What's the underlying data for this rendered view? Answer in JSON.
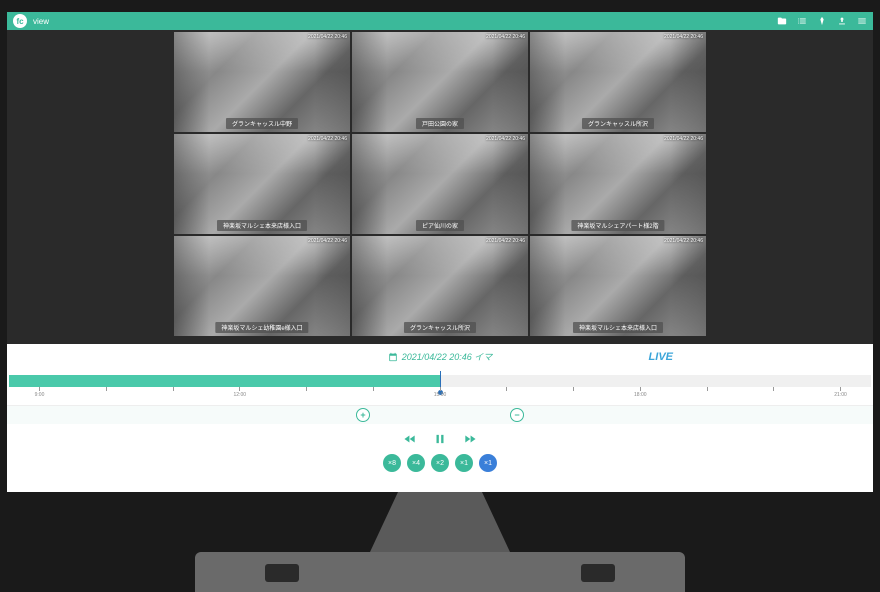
{
  "app": {
    "title": "view"
  },
  "header_icons": [
    "folder-icon",
    "list-icon",
    "diamond-icon",
    "upload-icon",
    "menu-icon"
  ],
  "cameras": [
    {
      "label": "グランキャッスル中野",
      "ts": "2021/04/22 20:46"
    },
    {
      "label": "戸田公園の家",
      "ts": "2021/04/22 20:46"
    },
    {
      "label": "グランキャッスル所沢",
      "ts": "2021/04/22 20:46"
    },
    {
      "label": "神楽坂マルシェ本来店様入口",
      "ts": "2021/04/22 20:46"
    },
    {
      "label": "ピア仙川の家",
      "ts": "2021/04/22 20:46"
    },
    {
      "label": "神楽坂マルシェアパート様2階",
      "ts": "2021/04/22 20:46"
    },
    {
      "label": "神楽坂マルシェ幼稚園e様入口",
      "ts": "2021/04/22 20:46"
    },
    {
      "label": "グランキャッスル所沢",
      "ts": "2021/04/22 20:46"
    },
    {
      "label": "神楽坂マルシェ本来店様入口",
      "ts": "2021/04/22 20:46"
    }
  ],
  "timeline": {
    "current": "2021/04/22 20:46 イマ",
    "live_label": "LIVE",
    "ticks": [
      "9:00",
      "",
      "",
      "12:00",
      "",
      "",
      "15:00",
      "",
      "",
      "18:00",
      "",
      "",
      "21:00"
    ]
  },
  "zoom": {
    "in": "+",
    "out": "−"
  },
  "speeds": [
    {
      "label": "×8"
    },
    {
      "label": "×4"
    },
    {
      "label": "×2"
    },
    {
      "label": "×1"
    },
    {
      "label": "×1",
      "active": true
    }
  ]
}
